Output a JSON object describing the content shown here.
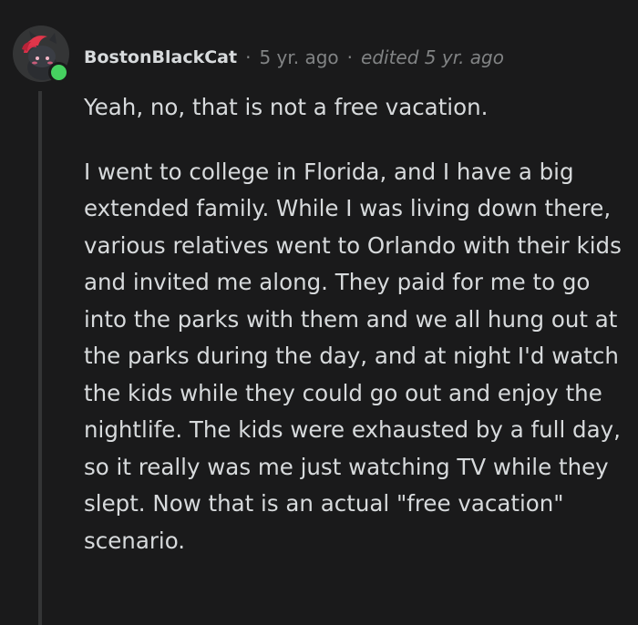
{
  "comment": {
    "author": "BostonBlackCat",
    "separator": "·",
    "posted": "5 yr. ago",
    "edited": "edited 5 yr. ago",
    "paragraphs": [
      "Yeah, no, that is not a free vacation.",
      "I went to college in Florida, and I have a big extended family. While I was living down there, various relatives went to Orlando with their kids and invited me along. They paid for me to go into the parks with them and we all hung out at the parks during the day, and at night I'd watch the kids while they could go out and enjoy the nightlife. The kids were exhausted by a full day, so it really was me just watching TV while they slept. Now that is an actual \"free vacation\" scenario."
    ],
    "online_status": "online",
    "avatar_icon": "snoo-avatar-icon"
  },
  "colors": {
    "background": "#1a1a1b",
    "text": "#d7dadc",
    "meta": "#818384",
    "thread_line": "#343536",
    "online": "#46d160",
    "avatar_hair": "#e0364a"
  }
}
